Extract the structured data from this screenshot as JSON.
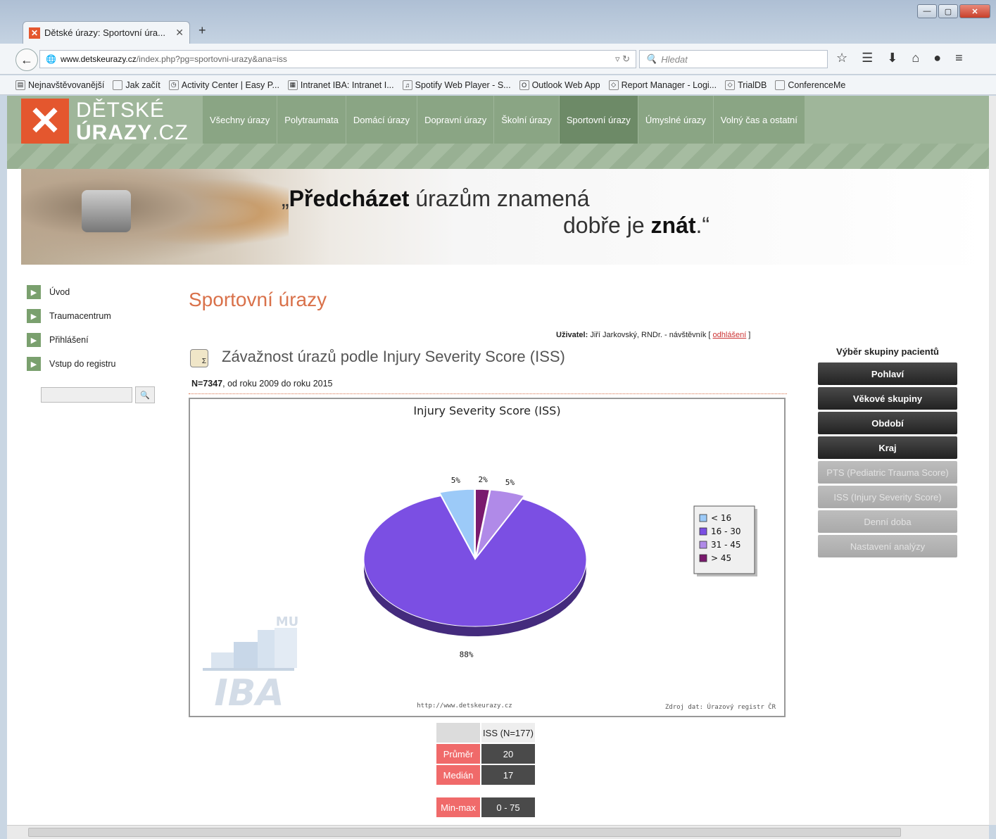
{
  "browser": {
    "tab_title": "Dětské úrazy: Sportovní úra...",
    "url_domain": "www.detskeurazy.cz",
    "url_path": "/index.php?pg=sportovni-urazy&ana=iss",
    "search_placeholder": "Hledat",
    "bookmarks": [
      "Nejnavštěvovanější",
      "Jak začít",
      "Activity Center | Easy P...",
      "Intranet IBA: Intranet I...",
      "Spotify Web Player - S...",
      "Outlook Web App",
      "Report Manager - Logi...",
      "TrialDB",
      "ConferenceMe"
    ]
  },
  "site": {
    "logo_line1": "DĚTSKÉ",
    "logo_line2": "ÚRAZY",
    "logo_suffix": ".CZ",
    "nav": [
      "Všechny úrazy",
      "Polytraumata",
      "Domácí úrazy",
      "Dopravní úrazy",
      "Školní úrazy",
      "Sportovní úrazy",
      "Úmyslné úrazy",
      "Volný čas a ostatní"
    ],
    "banner_quote_bold1": "Předcházet",
    "banner_quote_rest1": " úrazům znamená",
    "banner_quote_rest2": "dobře je ",
    "banner_quote_bold2": "znát"
  },
  "sidebar": {
    "items": [
      "Úvod",
      "Traumacentrum",
      "Přihlášení",
      "Vstup do registru"
    ]
  },
  "main": {
    "page_title": "Sportovní úrazy",
    "user_label": "Uživatel:",
    "user_name": "Jiří Jarkovský, RNDr. - návštěvník [",
    "logout": "odhlášení",
    "section_title": "Závažnost úrazů podle Injury Severity Score (ISS)",
    "n_label": "N=7347",
    "period": ", od roku 2009 do roku 2015",
    "chart_url": "http://www.detskeurazy.cz",
    "chart_source": "Zdroj dat: Úrazový registr ČR",
    "iba_text": "IBA",
    "mu_text": "MU"
  },
  "chart_data": {
    "type": "pie",
    "title": "Injury Severity Score (ISS)",
    "categories": [
      "< 16",
      "16 - 30",
      "31 - 45",
      "> 45"
    ],
    "values": [
      5,
      88,
      5,
      2
    ],
    "labels": [
      "5%",
      "88%",
      "5%",
      "2%"
    ],
    "colors": [
      "#9ccaf8",
      "#7b4fe3",
      "#b08ae8",
      "#7a1a6e"
    ],
    "legend_placement": "right"
  },
  "stats": {
    "header": "ISS (N=177)",
    "rows": [
      {
        "label": "Průměr",
        "value": "20"
      },
      {
        "label": "Medián",
        "value": "17"
      },
      {
        "label": "Min-max",
        "value": "0 - 75"
      }
    ]
  },
  "rightpanel": {
    "title": "Výběr skupiny pacientů",
    "buttons": [
      "Pohlaví",
      "Věkové skupiny",
      "Období",
      "Kraj"
    ],
    "disabled_buttons": [
      "PTS (Pediatric Trauma Score)",
      "ISS (Injury Severity Score)",
      "Denní doba",
      "Nastavení analýzy"
    ]
  }
}
